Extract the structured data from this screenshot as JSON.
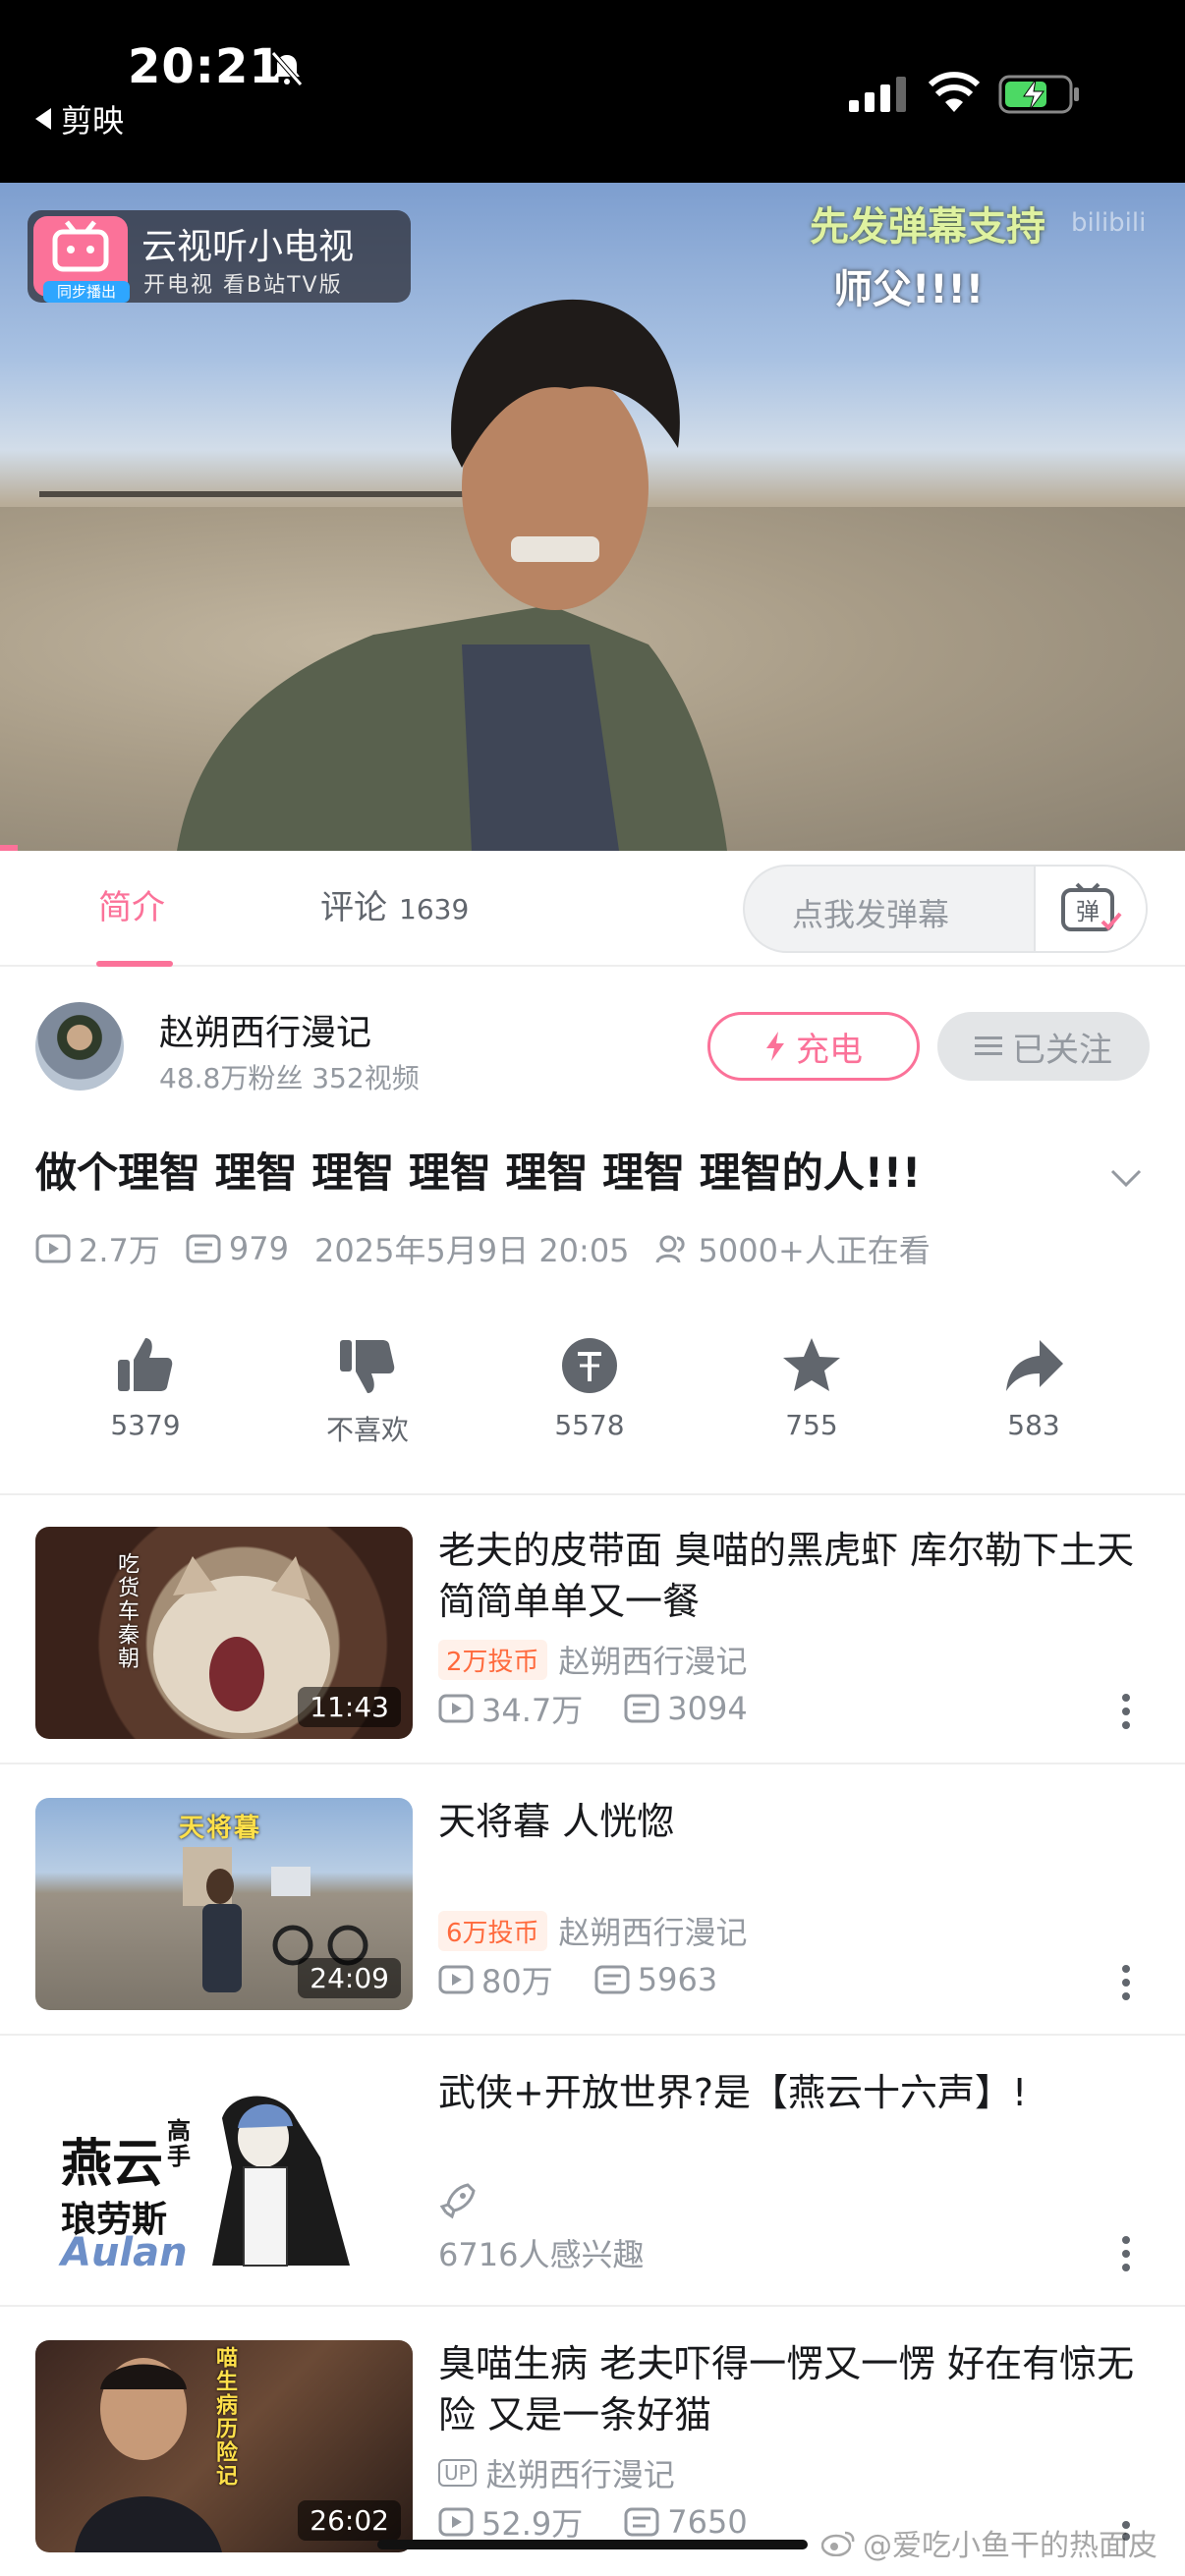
{
  "status_bar": {
    "time": "20:21",
    "back_app": "剪映"
  },
  "video": {
    "tv_badge_title": "云视听小电视",
    "tv_badge_subtitle": "开电视 看B站TV版",
    "tv_badge_logo_sub": "同步播出",
    "danmaku": [
      "先发弹幕支持",
      "师父!!!!"
    ],
    "watermark": "bilibili"
  },
  "tabs": {
    "intro": "简介",
    "comments": "评论",
    "comments_count": "1639",
    "danmaku_placeholder": "点我发弹幕",
    "danmaku_button": "弹"
  },
  "uploader": {
    "name": "赵朔西行漫记",
    "meta": "48.8万粉丝  352视频",
    "charge_label": "充电",
    "follow_label": "已关注"
  },
  "video_info": {
    "title": "做个理智 理智 理智 理智 理智 理智 理智的人!!!",
    "views": "2.7万",
    "danmaku_count": "979",
    "published": "2025年5月9日 20:05",
    "watching": "5000+人正在看"
  },
  "actions": {
    "like": "5379",
    "dislike": "不喜欢",
    "coin": "5578",
    "favorite": "755",
    "share": "583"
  },
  "recommendations": [
    {
      "title": "老夫的皮带面 臭喵的黑虎虾 库尔勒下土天 简简单单又一餐",
      "coins": "2万投币",
      "author": "赵朔西行漫记",
      "views": "34.7万",
      "danmaku": "3094",
      "duration": "11:43",
      "thumb_label": "吃货车秦朝"
    },
    {
      "title": "天将暮 人恍惚",
      "coins": "6万投币",
      "author": "赵朔西行漫记",
      "views": "80万",
      "danmaku": "5963",
      "duration": "24:09",
      "thumb_label": "天将暮"
    },
    {
      "title": "武侠+开放世界?是【燕云十六声】!",
      "interest": "6716人感兴趣",
      "thumb_text1": "燕云",
      "thumb_text1b": "高手",
      "thumb_text2": "琅劳斯",
      "thumb_text3": "Aulan"
    },
    {
      "title": "臭喵生病 老夫吓得一愣又一愣 好在有惊无险 又是一条好猫",
      "up_badge": "UP",
      "author": "赵朔西行漫记",
      "views": "52.9万",
      "danmaku": "7650",
      "duration": "26:02",
      "thumb_label": "喵生病历险记"
    }
  ],
  "watermark": "@爱吃小鱼干的热面皮",
  "colors": {
    "accent": "#fb7299",
    "coin": "#ff6a3d",
    "secondary_text": "#9499a0"
  }
}
